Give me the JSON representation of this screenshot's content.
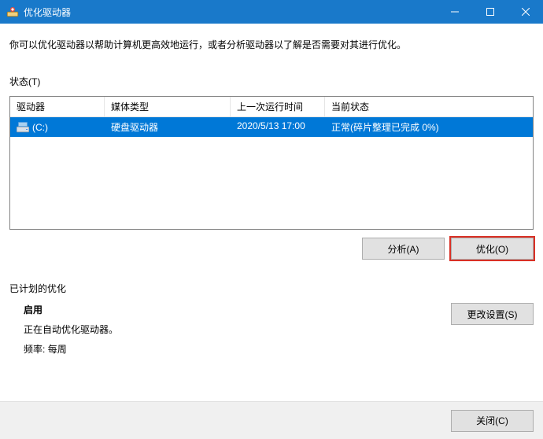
{
  "titlebar": {
    "title": "优化驱动器"
  },
  "description": "你可以优化驱动器以帮助计算机更高效地运行，或者分析驱动器以了解是否需要对其进行优化。",
  "status_label": "状态(T)",
  "table": {
    "headers": {
      "drive": "驱动器",
      "media": "媒体类型",
      "lastrun": "上一次运行时间",
      "status": "当前状态"
    },
    "rows": [
      {
        "drive": "(C:)",
        "media": "硬盘驱动器",
        "lastrun": "2020/5/13 17:00",
        "status": "正常(碎片整理已完成 0%)"
      }
    ]
  },
  "buttons": {
    "analyze": "分析(A)",
    "optimize": "优化(O)",
    "change_settings": "更改设置(S)",
    "close": "关闭(C)"
  },
  "scheduled": {
    "label": "已计划的优化",
    "status": "启用",
    "desc": "正在自动优化驱动器。",
    "freq_label": "频率:",
    "freq_value": "每周"
  }
}
